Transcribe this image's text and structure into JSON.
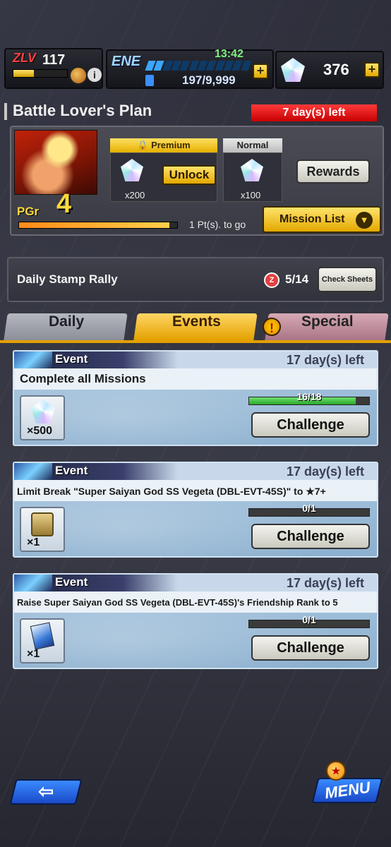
{
  "status": {
    "level_tag": "ZLV",
    "level": "117",
    "info_icon": "i",
    "ene_label": "ENE",
    "ene_time": "13:42",
    "ene_value": "197/9,999",
    "ene_plus": "+",
    "gems": "376",
    "gems_plus": "+"
  },
  "plan": {
    "title": "Battle Lover's Plan",
    "days_left": "7 day(s) left",
    "premium_label": "Premium",
    "premium_qty": "x200",
    "unlock_label": "Unlock",
    "normal_label": "Normal",
    "normal_qty": "x100",
    "rewards_label": "Rewards",
    "pgr_label": "PGr",
    "pgr_value": "4",
    "progress": 0.95,
    "pts_to_go": "1 Pt(s). to go",
    "mission_list_label": "Mission List"
  },
  "stamp_rally": {
    "label": "Daily Stamp Rally",
    "icon_text": "Z",
    "count": "5/14",
    "check_label": "Check Sheets"
  },
  "tabs": {
    "daily": "Daily",
    "events": "Events",
    "special": "Special",
    "special_badge": "!"
  },
  "missions": [
    {
      "tag": "Event",
      "days": "17 day(s) left",
      "title": "Complete all Missions",
      "reward_qty": "×500",
      "reward_icon": "crystal-icon",
      "progress_text": "16/18",
      "progress": 0.889,
      "button": "Challenge"
    },
    {
      "tag": "Event",
      "days": "17 day(s) left",
      "title": "Limit Break \"Super Saiyan God SS Vegeta (DBL-EVT-45S)\" to ★7+",
      "reward_qty": "×1",
      "reward_icon": "limit-break-medal-icon",
      "progress_text": "0/1",
      "progress": 0,
      "button": "Challenge"
    },
    {
      "tag": "Event",
      "days": "17 day(s) left",
      "title": "Raise Super Saiyan God SS Vegeta (DBL-EVT-45S)'s Friendship Rank to 5",
      "reward_qty": "×1",
      "reward_icon": "ticket-icon",
      "progress_text": "0/1",
      "progress": 0,
      "button": "Challenge"
    }
  ],
  "nav": {
    "back": "⇦",
    "menu": "MENU",
    "menu_ball": "★"
  }
}
